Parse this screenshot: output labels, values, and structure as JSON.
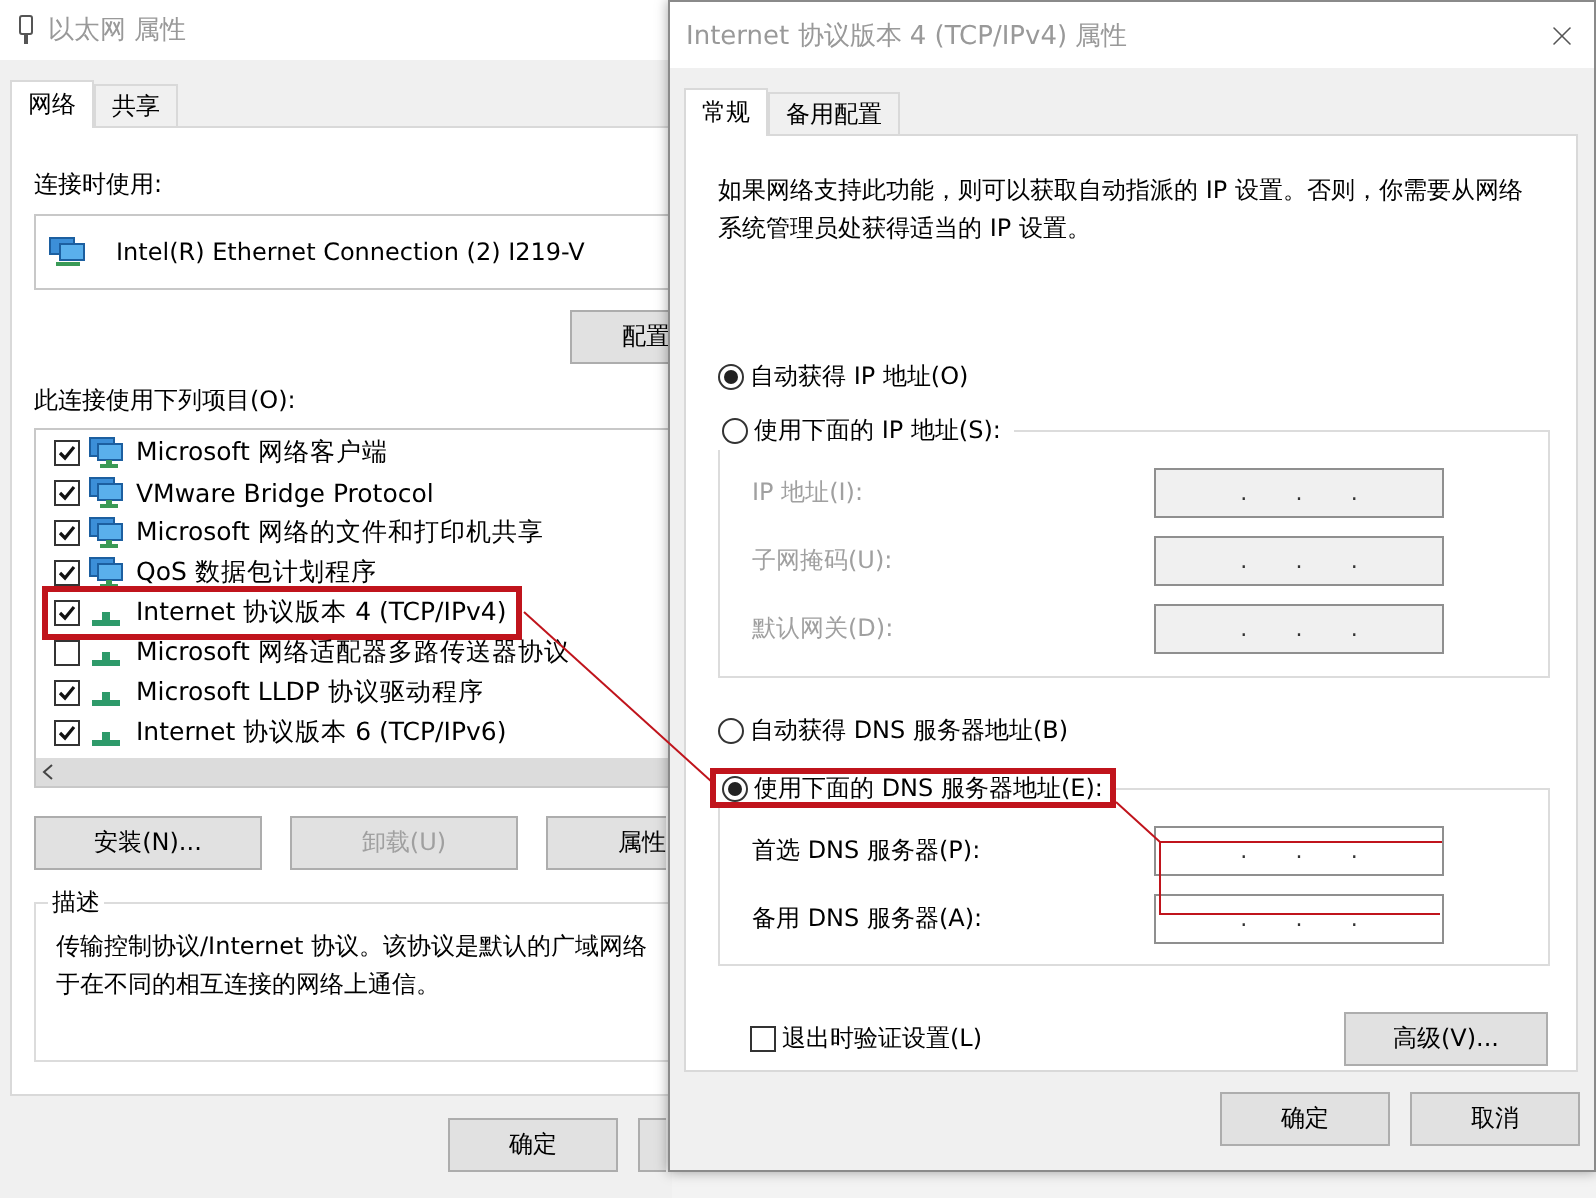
{
  "back_window": {
    "title": "以太网 属性",
    "tabs": [
      {
        "label": "网络",
        "selected": true
      },
      {
        "label": "共享",
        "selected": false
      }
    ],
    "connect_using_label": "连接时使用:",
    "adapter": "Intel(R) Ethernet Connection (2) I219-V",
    "configure_button": "配置",
    "items_label": "此连接使用下列项目(O):",
    "items": [
      {
        "label": "Microsoft 网络客户端",
        "checked": true,
        "kind": "service",
        "highlighted": false
      },
      {
        "label": "VMware Bridge Protocol",
        "checked": true,
        "kind": "service",
        "highlighted": false
      },
      {
        "label": "Microsoft 网络的文件和打印机共享",
        "checked": true,
        "kind": "service",
        "highlighted": false
      },
      {
        "label": "QoS 数据包计划程序",
        "checked": true,
        "kind": "service",
        "highlighted": false
      },
      {
        "label": "Internet 协议版本 4 (TCP/IPv4)",
        "checked": true,
        "kind": "protocol",
        "highlighted": true
      },
      {
        "label": "Microsoft 网络适配器多路传送器协议",
        "checked": false,
        "kind": "protocol",
        "highlighted": false
      },
      {
        "label": "Microsoft LLDP 协议驱动程序",
        "checked": true,
        "kind": "protocol",
        "highlighted": false
      },
      {
        "label": "Internet 协议版本 6 (TCP/IPv6)",
        "checked": true,
        "kind": "protocol",
        "highlighted": false
      }
    ],
    "action_buttons": [
      {
        "label": "安装(N)...",
        "disabled": false
      },
      {
        "label": "卸载(U)",
        "disabled": true
      },
      {
        "label": "属性",
        "disabled": false
      }
    ],
    "description": {
      "title": "描述",
      "lines": [
        "传输控制协议/Internet 协议。该协议是默认的广域网络",
        "于在不同的相互连接的网络上通信。"
      ]
    },
    "ok_button": "确定"
  },
  "front_window": {
    "title": "Internet 协议版本 4 (TCP/IPv4) 属性",
    "tabs": [
      {
        "label": "常规",
        "selected": true
      },
      {
        "label": "备用配置",
        "selected": false
      }
    ],
    "intro": "如果网络支持此功能，则可以获取自动指派的 IP 设置。否则，你需要从网络系统管理员处获得适当的 IP 设置。",
    "ip_auto": {
      "label": "自动获得 IP 地址(O)",
      "selected": true
    },
    "ip_manual": {
      "label": "使用下面的 IP 地址(S):",
      "selected": false,
      "highlighted": false,
      "fields": [
        {
          "label": "IP 地址(I):",
          "separators": [
            ".",
            ".",
            "."
          ],
          "disabled": true
        },
        {
          "label": "子网掩码(U):",
          "separators": [
            ".",
            ".",
            "."
          ],
          "disabled": true
        },
        {
          "label": "默认网关(D):",
          "separators": [
            ".",
            ".",
            "."
          ],
          "disabled": true
        }
      ]
    },
    "dns_auto": {
      "label": "自动获得 DNS 服务器地址(B)",
      "selected": false
    },
    "dns_manual": {
      "label": "使用下面的 DNS 服务器地址(E):",
      "selected": true,
      "highlighted": true,
      "fields": [
        {
          "label": "首选 DNS 服务器(P):",
          "separators": [
            ".",
            ".",
            "."
          ],
          "disabled": false
        },
        {
          "label": "备用 DNS 服务器(A):",
          "separators": [
            ".",
            ".",
            "."
          ],
          "disabled": false
        }
      ]
    },
    "validate_checkbox": {
      "label": "退出时验证设置(L)",
      "checked": false
    },
    "advanced_button": "高级(V)...",
    "ok_button": "确定",
    "cancel_button": "取消"
  }
}
